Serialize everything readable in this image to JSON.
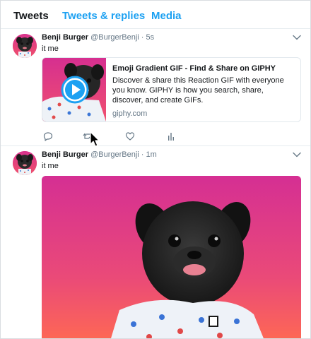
{
  "tabs": [
    {
      "label": "Tweets",
      "active": true
    },
    {
      "label": "Tweets & replies",
      "active": false
    },
    {
      "label": "Media",
      "active": false
    }
  ],
  "colors": {
    "accent": "#1da1f2",
    "text_primary": "#14171a",
    "text_secondary": "#657786",
    "divider": "#e6ecf0",
    "gif_gradient_top": "#e0338f",
    "gif_gradient_bottom": "#ff6b4a"
  },
  "tweets": [
    {
      "name": "Benji Burger",
      "handle": "@BurgerBenji",
      "dot": "·",
      "time": "5s",
      "text": "it me",
      "card": {
        "title": "Emoji Gradient GIF - Find & Share on GIPHY",
        "description": "Discover & share this Reaction GIF with everyone you know. GIPHY is how you search, share, discover, and create GIFs.",
        "domain": "giphy.com",
        "thumb_icon": "play-icon"
      },
      "actions": [
        "reply-icon",
        "retweet-icon",
        "like-icon",
        "analytics-icon"
      ]
    },
    {
      "name": "Benji Burger",
      "handle": "@BurgerBenji",
      "dot": "·",
      "time": "1m",
      "text": "it me",
      "media": "pug-gif"
    }
  ]
}
